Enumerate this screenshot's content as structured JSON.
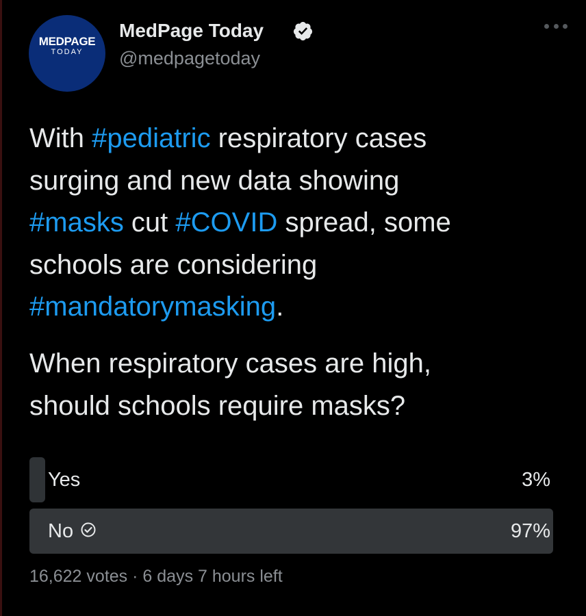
{
  "account": {
    "avatar_line1": "MEDPAGE",
    "avatar_line2": "TODAY",
    "display_name": "MedPage Today",
    "handle": "@medpagetoday",
    "verified_icon": "verified-badge-icon",
    "more_icon": "more-options-icon"
  },
  "tweet": {
    "lines": [
      [
        {
          "text": "With "
        },
        {
          "text": "#pediatric",
          "tag": true
        },
        {
          "text": " respiratory cases"
        }
      ],
      [
        {
          "text": "surging and new data showing"
        }
      ],
      [
        {
          "text": "#masks",
          "tag": true
        },
        {
          "text": " cut "
        },
        {
          "text": "#COVID",
          "tag": true
        },
        {
          "text": " spread, some"
        }
      ],
      [
        {
          "text": "schools are considering"
        }
      ],
      [
        {
          "text": "#mandatorymasking",
          "tag": true
        },
        {
          "text": "."
        }
      ]
    ],
    "question_lines": [
      "When respiratory cases are high,",
      "should schools require masks?"
    ]
  },
  "poll": {
    "options": [
      {
        "label": "Yes",
        "percent_text": "3%",
        "percent": 3,
        "selected": false
      },
      {
        "label": "No",
        "percent_text": "97%",
        "percent": 97,
        "selected": true
      }
    ],
    "votes": "16,622 votes",
    "separator": "·",
    "time_left": "6 days 7 hours left"
  },
  "colors": {
    "background": "#000000",
    "text": "#e7e9ea",
    "muted": "#8b8f94",
    "hashtag": "#1d9bf0",
    "poll_fill": "#333639",
    "avatar": "#0a2d78"
  }
}
